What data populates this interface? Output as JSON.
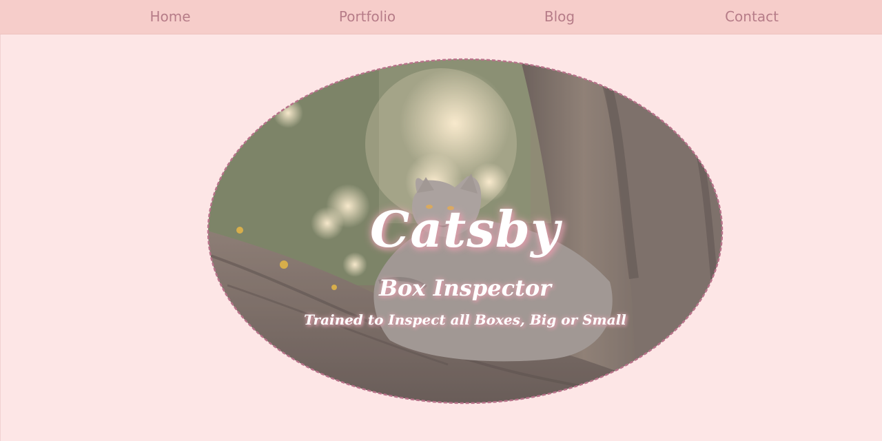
{
  "nav": {
    "items": [
      {
        "label": "Home"
      },
      {
        "label": "Portfolio"
      },
      {
        "label": "Blog"
      },
      {
        "label": "Contact"
      }
    ]
  },
  "hero": {
    "title": "Catsby",
    "subtitle": "Box Inspector",
    "tagline": "Trained to Inspect all Boxes, Big or Small",
    "image_subject": "cat resting on a tree branch"
  },
  "colors": {
    "page_background": "#fde6e6",
    "nav_background": "#f6cdca",
    "nav_text": "#b67c88",
    "hero_border": "#b8728a",
    "hero_text": "#ffffff",
    "text_glow": "#d99aa7"
  }
}
